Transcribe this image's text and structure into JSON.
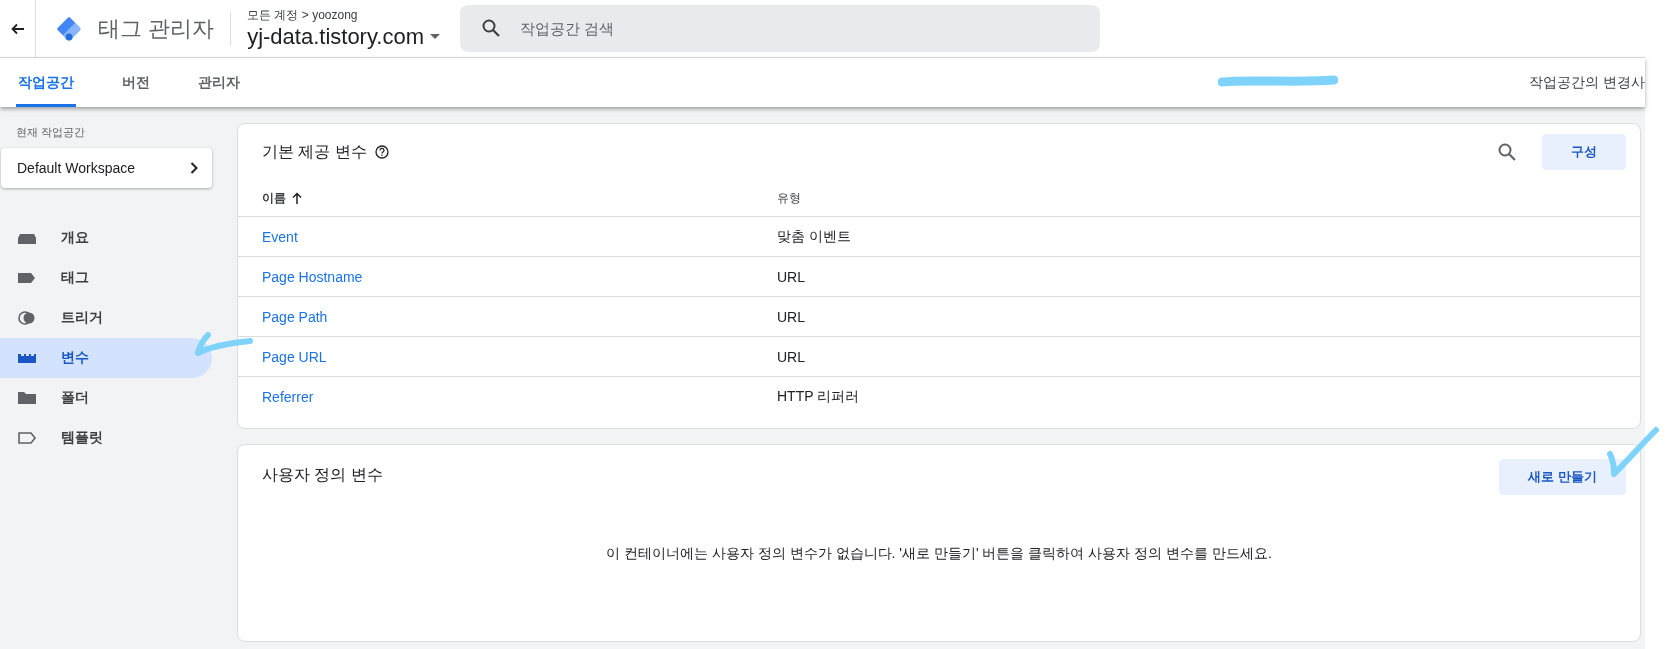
{
  "header": {
    "app_title": "태그 관리자",
    "breadcrumb": "모든 계정 > yoozong",
    "container": "yj-data.tistory.com",
    "search": {
      "placeholder": "작업공간 검색"
    }
  },
  "tabs": [
    {
      "label": "작업공간",
      "selected": true
    },
    {
      "label": "버전",
      "selected": false
    },
    {
      "label": "관리자",
      "selected": false
    }
  ],
  "workspace_changes": "작업공간의 변경사",
  "sidebar": {
    "workspace_label": "현재 작업공간",
    "workspace": "Default Workspace",
    "items": [
      {
        "label": "개요",
        "selected": false
      },
      {
        "label": "태그",
        "selected": false
      },
      {
        "label": "트리거",
        "selected": false
      },
      {
        "label": "변수",
        "selected": true
      },
      {
        "label": "폴더",
        "selected": false
      },
      {
        "label": "템플릿",
        "selected": false
      }
    ]
  },
  "builtin_variables": {
    "title": "기본 제공 변수",
    "button": "구성",
    "columns": [
      "이름",
      "유형"
    ],
    "rows": [
      {
        "name": "Event",
        "type": "맞춤 이벤트"
      },
      {
        "name": "Page Hostname",
        "type": "URL"
      },
      {
        "name": "Page Path",
        "type": "URL"
      },
      {
        "name": "Page URL",
        "type": "URL"
      },
      {
        "name": "Referrer",
        "type": "HTTP 리퍼러"
      }
    ]
  },
  "user_variables": {
    "title": "사용자 정의 변수",
    "button": "새로 만들기",
    "empty_message": "이 컨테이너에는 사용자 정의 변수가 없습니다. '새로 만들기' 버튼을 클릭하여 사용자 정의 변수를 만드세요."
  }
}
